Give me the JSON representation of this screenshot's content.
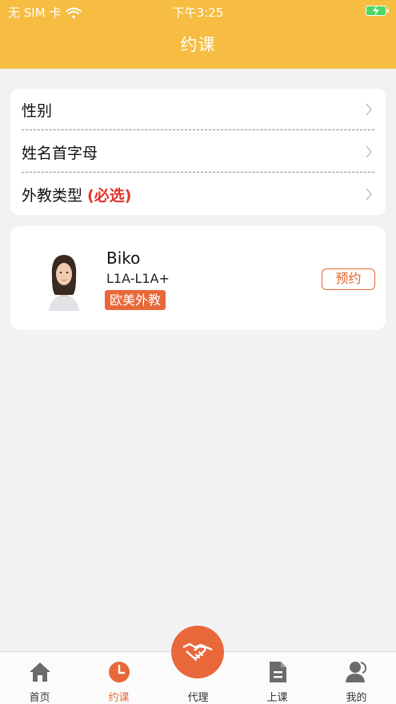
{
  "status_bar": {
    "carrier": "无 SIM 卡",
    "time": "下午3:25"
  },
  "nav": {
    "title": "约课"
  },
  "filters": [
    {
      "label": "性别",
      "required_note": ""
    },
    {
      "label": "姓名首字母",
      "required_note": ""
    },
    {
      "label": "外教类型",
      "required_note": "(必选)"
    }
  ],
  "teacher": {
    "name": "Biko",
    "level": "L1A-L1A+",
    "tag": "欧美外教",
    "action_label": "预约"
  },
  "tabs": [
    {
      "label": "首页",
      "icon": "home-icon",
      "active": false
    },
    {
      "label": "约课",
      "icon": "clock-icon",
      "active": true
    },
    {
      "label": "代理",
      "icon": "handshake-icon",
      "active": false
    },
    {
      "label": "上课",
      "icon": "document-icon",
      "active": false
    },
    {
      "label": "我的",
      "icon": "user-icon",
      "active": false
    }
  ],
  "colors": {
    "header": "#f6bd42",
    "accent": "#e8683a",
    "required": "#e1342b",
    "background": "#f2f2f2"
  }
}
